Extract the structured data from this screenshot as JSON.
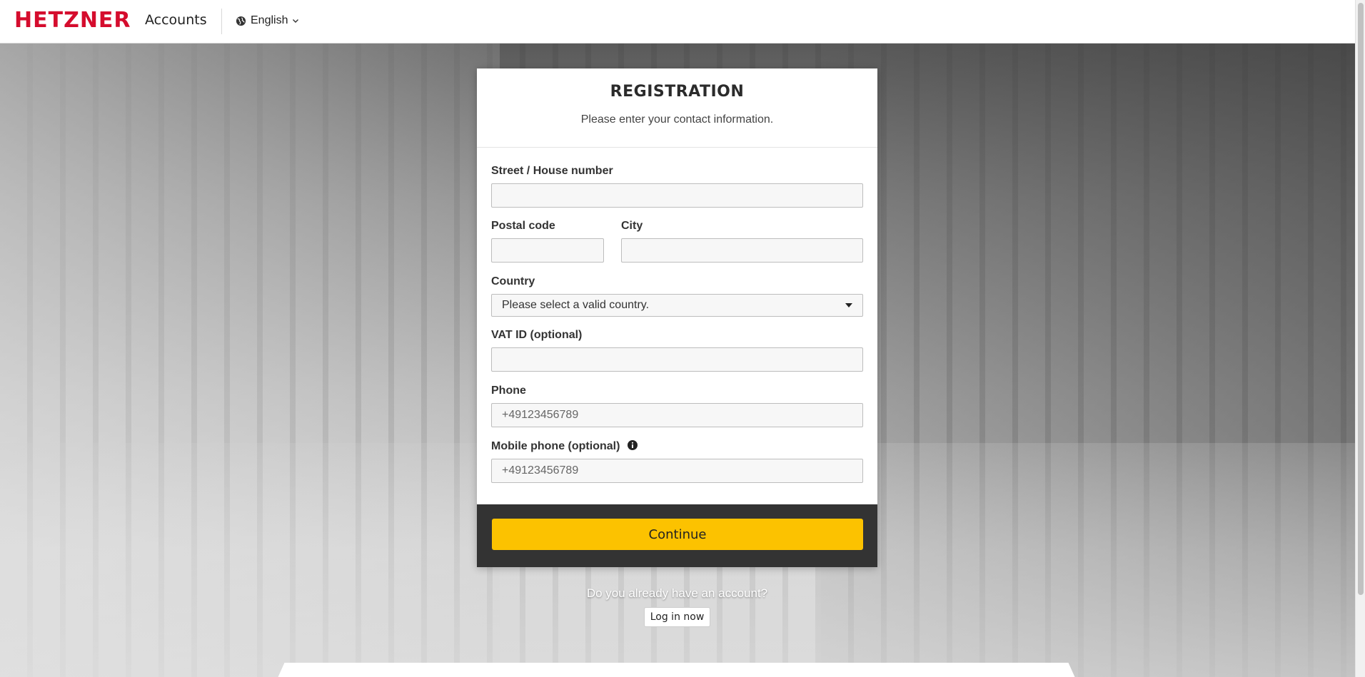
{
  "header": {
    "brand": "HETZNER",
    "app_name": "Accounts",
    "language": "English"
  },
  "registration": {
    "title": "REGISTRATION",
    "subtitle": "Please enter your contact information.",
    "fields": {
      "street": {
        "label": "Street / House number",
        "value": "",
        "placeholder": ""
      },
      "postal_code": {
        "label": "Postal code",
        "value": "",
        "placeholder": ""
      },
      "city": {
        "label": "City",
        "value": "",
        "placeholder": ""
      },
      "country": {
        "label": "Country",
        "selected": "Please select a valid country."
      },
      "vat_id": {
        "label": "VAT ID (optional)",
        "value": "",
        "placeholder": ""
      },
      "phone": {
        "label": "Phone",
        "value": "",
        "placeholder": "+49123456789"
      },
      "mobile_phone": {
        "label": "Mobile phone (optional)",
        "value": "",
        "placeholder": "+49123456789"
      }
    },
    "continue_label": "Continue"
  },
  "login_prompt": {
    "question": "Do you already have an account?",
    "button_label": "Log in now"
  },
  "colors": {
    "brand_red": "#d50c2d",
    "primary_button": "#fcc200",
    "footer_dark": "#333333"
  },
  "icons": {
    "language": "globe-icon",
    "language_menu": "chevron-down-icon",
    "country_select": "caret-down-icon",
    "mobile_info": "info-icon"
  }
}
